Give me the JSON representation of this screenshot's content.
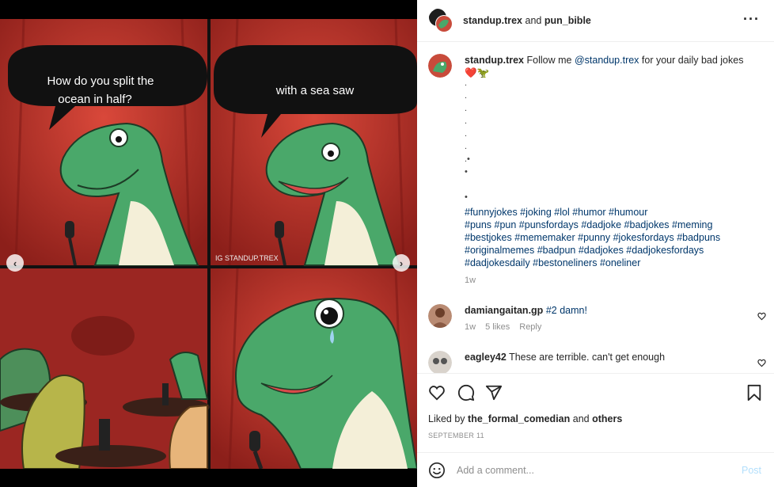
{
  "post": {
    "owner": "standup.trex",
    "coauthor_joiner": "and",
    "coauthor": "pun_bible"
  },
  "comic": {
    "panel1_bubble": [
      "How do you split the",
      "ocean in half?"
    ],
    "panel2_bubble": "with a sea saw",
    "watermark": "IG STANDUP.TREX",
    "slides": 5,
    "active_slide": 4
  },
  "caption": {
    "username": "standup.trex",
    "text_before": "Follow me",
    "mention": "@standup.trex",
    "text_after": "for your daily bad jokes",
    "emoji": "❤️🦖",
    "dots": [
      ".",
      ".",
      ".",
      ".",
      ".",
      ".",
      ".•",
      "•",
      "",
      "•"
    ],
    "hashtags": [
      "#funnyjokes #joking #lol #humor #humour",
      "#puns #pun #punsfordays #dadjoke #badjokes #meming",
      "#bestjokes #mememaker #punny #jokesfordays #badpuns",
      "#originalmemes #badpun #dadjokes #dadjokesfordays",
      "#dadjokesdaily #bestoneliners #oneliner"
    ],
    "time": "1w"
  },
  "comments": [
    {
      "username": "damiangaitan.gp",
      "text": "#2 damn!",
      "time": "1w",
      "likes": "5 likes",
      "reply": "Reply"
    },
    {
      "username": "eagley42",
      "text": "These are terrible. can't get enough"
    }
  ],
  "likes": {
    "prefix": "Liked by",
    "user": "the_formal_comedian",
    "joiner": "and",
    "others": "others"
  },
  "date": "SEPTEMBER 11",
  "comment_input": {
    "placeholder": "Add a comment..."
  },
  "post_button": "Post",
  "icons": [
    "heart-icon",
    "comment-icon",
    "share-icon",
    "bookmark-icon",
    "emoji-icon",
    "more-icon"
  ],
  "colors": {
    "accent": "#3897f0",
    "link": "#00376b",
    "post_disabled": "#b2dffc",
    "heart": "#ed4956",
    "dino_green": "#4aa86a"
  }
}
